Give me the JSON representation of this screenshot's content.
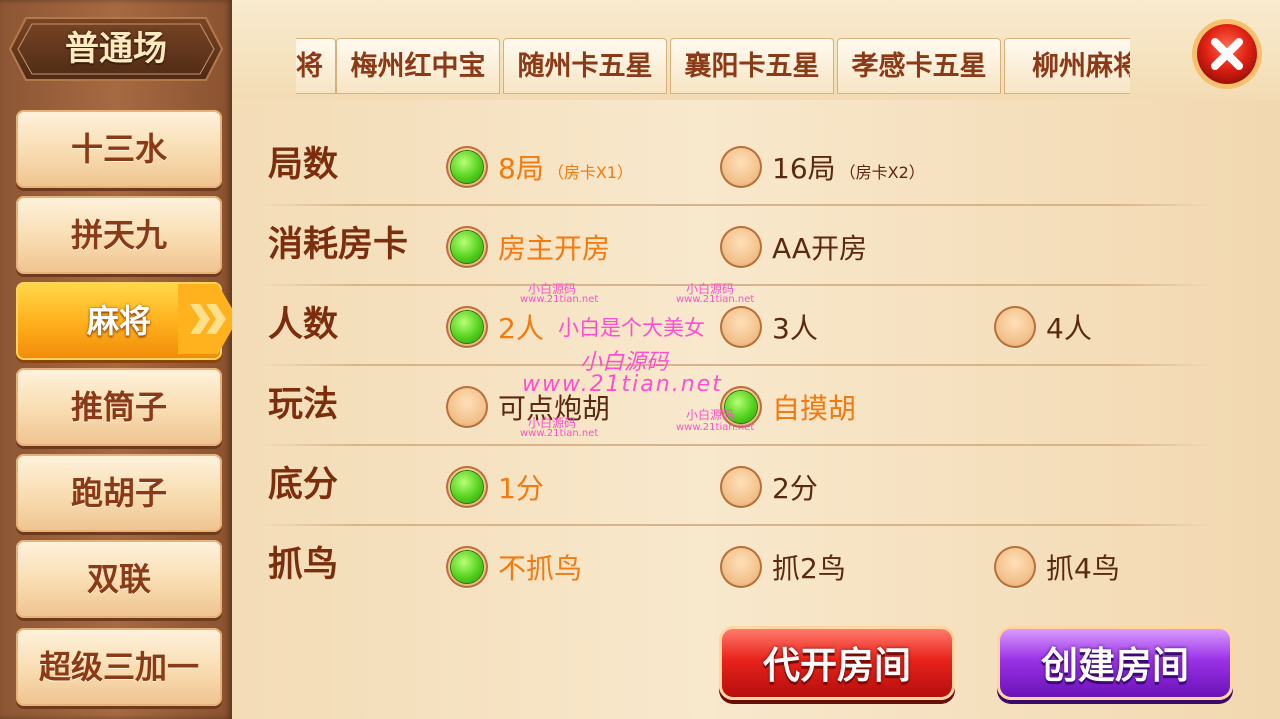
{
  "sidebar": {
    "mode_title": "普通场",
    "items": [
      {
        "label": "十三水",
        "active": false
      },
      {
        "label": "拼天九",
        "active": false
      },
      {
        "label": "麻将",
        "active": true
      },
      {
        "label": "推筒子",
        "active": false
      },
      {
        "label": "跑胡子",
        "active": false
      },
      {
        "label": "双联",
        "active": false
      },
      {
        "label": "超级三加一",
        "active": false
      }
    ]
  },
  "tabs": [
    {
      "label": "将"
    },
    {
      "label": "梅州红中宝"
    },
    {
      "label": "随州卡五星"
    },
    {
      "label": "襄阳卡五星"
    },
    {
      "label": "孝感卡五星"
    },
    {
      "label": "柳州麻将"
    }
  ],
  "rows": [
    {
      "label": "局数",
      "options": [
        {
          "label": "8局",
          "sub": "（房卡X1）",
          "selected": true
        },
        {
          "label": "16局",
          "sub": "（房卡X2）",
          "selected": false
        }
      ]
    },
    {
      "label": "消耗房卡",
      "options": [
        {
          "label": "房主开房",
          "selected": true
        },
        {
          "label": "AA开房",
          "selected": false
        }
      ]
    },
    {
      "label": "人数",
      "options": [
        {
          "label": "2人",
          "selected": true
        },
        {
          "label": "3人",
          "selected": false
        },
        {
          "label": "4人",
          "selected": false
        }
      ]
    },
    {
      "label": "玩法",
      "options": [
        {
          "label": "可点炮胡",
          "selected": false
        },
        {
          "label": "自摸胡",
          "selected": true
        }
      ]
    },
    {
      "label": "底分",
      "options": [
        {
          "label": "1分",
          "selected": true
        },
        {
          "label": "2分",
          "selected": false
        }
      ]
    },
    {
      "label": "抓鸟",
      "options": [
        {
          "label": "不抓鸟",
          "selected": true
        },
        {
          "label": "抓2鸟",
          "selected": false
        },
        {
          "label": "抓4鸟",
          "selected": false
        }
      ]
    }
  ],
  "actions": {
    "proxy_open": "代开房间",
    "create_room": "创建房间"
  },
  "close_icon": "close-icon",
  "watermarks": {
    "main": "小白是个大美女",
    "brand": "小白源码",
    "url": "www.21tian.net",
    "small_name": "小白源码",
    "small_url": "www.21tian.net"
  },
  "colors": {
    "selected_text": "#f37a0f",
    "label_text": "#7a2e0e",
    "radio_on": "#54d21e",
    "active_tab": "#ffb21e"
  }
}
